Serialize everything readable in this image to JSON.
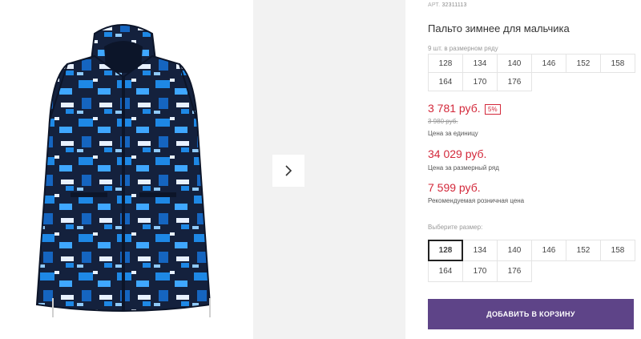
{
  "product": {
    "article_label": "АРТ.",
    "article_number": "32311113",
    "title": "Пальто зимнее для мальчика"
  },
  "size_row": {
    "note": "9 шт. в размерном ряду",
    "sizes": [
      "128",
      "134",
      "140",
      "146",
      "152",
      "158",
      "164",
      "170",
      "176"
    ]
  },
  "pricing": {
    "unit_price": "3 781 руб.",
    "discount": "5%",
    "old_price": "3 980 руб.",
    "unit_label": "Цена за единицу",
    "row_price": "34 029 руб.",
    "row_label": "Цена за размерный ряд",
    "retail_price": "7 599 руб.",
    "retail_label": "Рекомендуемая розничная цена"
  },
  "size_picker": {
    "label": "Выберите размер:",
    "sizes": [
      "128",
      "134",
      "140",
      "146",
      "152",
      "158",
      "164",
      "170",
      "176"
    ],
    "selected": "128"
  },
  "cart_button": "ДОБАВИТЬ В КОРЗИНУ",
  "colors": {
    "price": "#d3283a",
    "button": "#5e4488",
    "coat_dark": "#14213d",
    "coat_blue": "#1e88e5"
  }
}
